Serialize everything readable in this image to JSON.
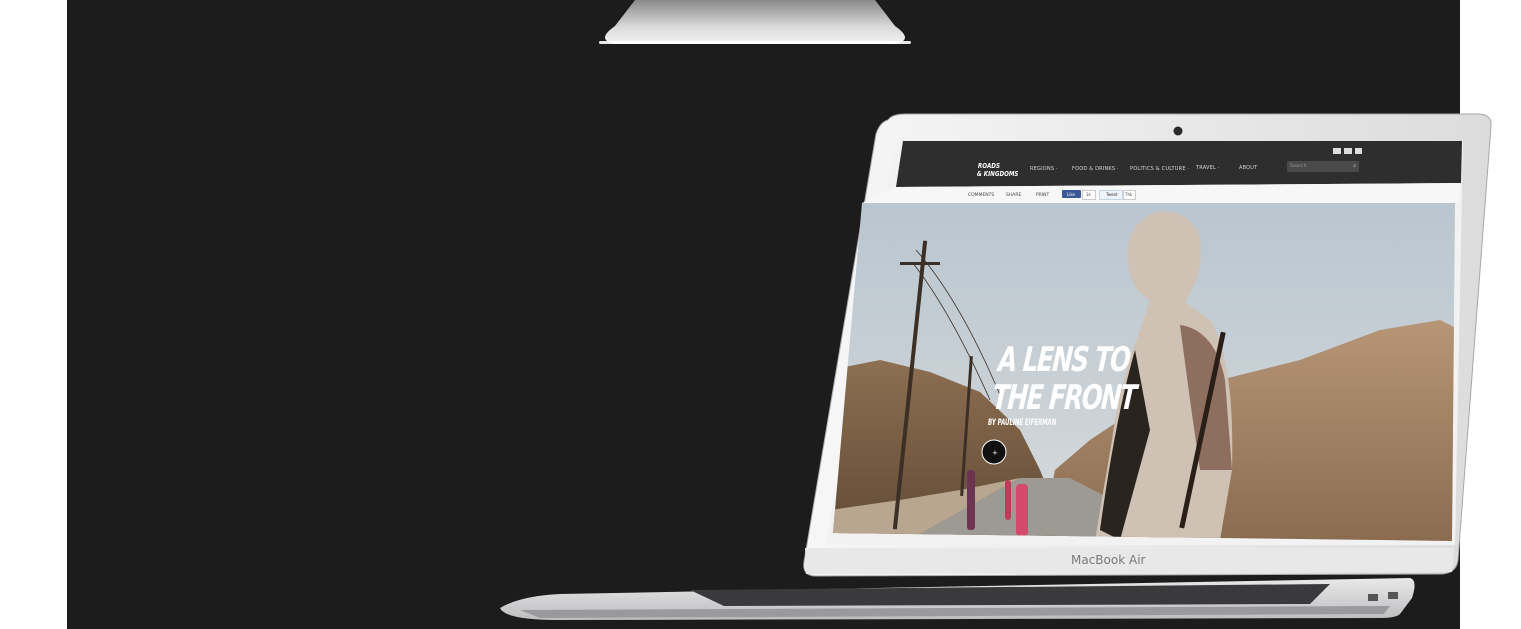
{
  "site": {
    "logo_line1": "ROADS",
    "logo_line2": "& KINGDOMS",
    "nav": [
      "REGIONS ·",
      "FOOD & DRINKS ·",
      "POLITICS & CULTURE ·",
      "TRAVEL ·",
      "ABOUT"
    ],
    "search_placeholder": "Search",
    "share": {
      "comments": "COMMENTS",
      "share": "SHARE",
      "print": "PRINT",
      "like": "Like",
      "like_count": "1k",
      "tweet": "Tweet",
      "tweet_count": "7hk"
    }
  },
  "hero": {
    "title_line1": "A LENS TO",
    "title_line2": "THE FRONT",
    "byline": "BY PAULINE EIFERMAN"
  },
  "device": {
    "brand": "MacBook",
    "model": "Air"
  },
  "colors": {
    "stage_bg": "#1c1c1c",
    "navbar_bg": "#2e2e2e",
    "facebook_blue": "#3b5998",
    "twitter_blue": "#55acee"
  }
}
